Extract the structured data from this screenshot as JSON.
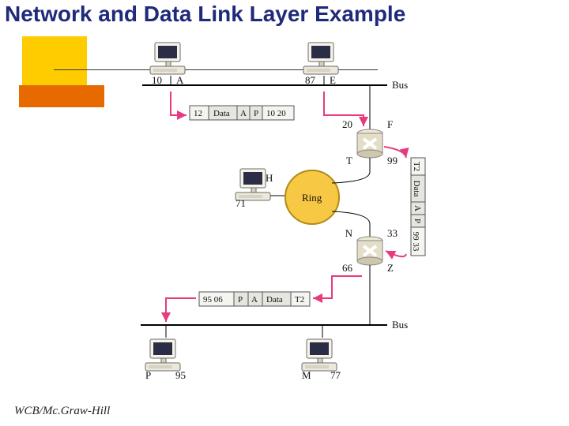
{
  "title": "Network and Data Link Layer Example",
  "footer": "WCB/Mc.Graw-Hill",
  "labels": {
    "bus1": "Bus",
    "bus2": "Bus",
    "ring": "Ring",
    "pcA_addr": "10",
    "pcA_name": "A",
    "pcE_addr": "87",
    "pcE_name": "E",
    "routerF_top_addr": "20",
    "routerF_top_name": "F",
    "routerF_bot_addr": "99",
    "routerF_bot_name": "T",
    "pcH_addr": "71",
    "pcH_name": "H",
    "routerN_top_addr": "33",
    "routerN_top_name": "N",
    "routerN_bot_addr": "66",
    "routerN_bot_name": "Z",
    "pcP_addr": "95",
    "pcP_name": "P",
    "pcM_addr": "77",
    "pcM_name": "M"
  },
  "packets": {
    "pkt1": {
      "dl_dest": "12",
      "net_data": "Data",
      "net_src": "A",
      "net_dest": "P",
      "dl_trailer": "10 20"
    },
    "pkt2": {
      "dl_dest": "T2",
      "net_data": "Data",
      "net_src": "A",
      "net_dest": "P",
      "dl_trailer": "99 33"
    },
    "pkt3": {
      "dl_dest": "95 06",
      "net_src": "P",
      "net_dest": "A",
      "net_data": "Data",
      "dl_trailer": "T2"
    }
  }
}
